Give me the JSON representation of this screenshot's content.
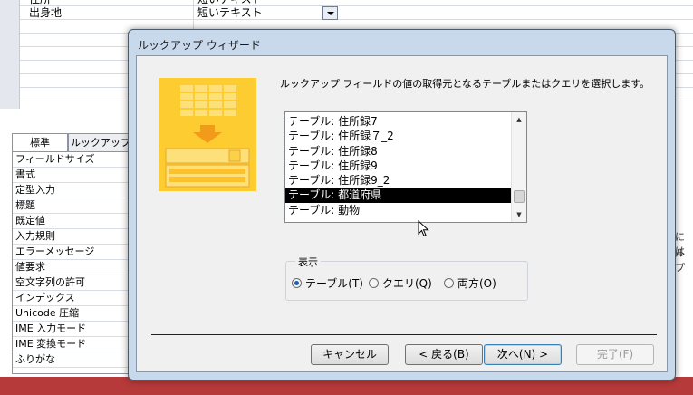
{
  "background": {
    "field_rows": [
      {
        "name": "住所",
        "type": "短いテキスト"
      },
      {
        "name": "出身地",
        "type": "短いテキスト"
      }
    ],
    "tabs": [
      "標準",
      "ルックアップ"
    ],
    "properties": [
      "フィールドサイズ",
      "書式",
      "定型入力",
      "標題",
      "既定値",
      "入力規則",
      "エラーメッセージ",
      "値要求",
      "空文字列の許可",
      "インデックス",
      "Unicode 圧縮",
      "IME 入力モード",
      "IME 変換モード",
      "ふりがな"
    ],
    "side_texts": [
      "には",
      "ルプ"
    ]
  },
  "dialog": {
    "title": "ルックアップ ウィザード",
    "instruction": "ルックアップ フィールドの値の取得元となるテーブルまたはクエリを選択します。",
    "list_items": [
      "テーブル: 住所録7",
      "テーブル: 住所録７_2",
      "テーブル: 住所録8",
      "テーブル: 住所録9",
      "テーブル: 住所録9_2",
      "テーブル: 都道府県",
      "テーブル: 動物"
    ],
    "selected_index": 5,
    "group_label": "表示",
    "radios": [
      {
        "label": "テーブル(T)",
        "checked": true
      },
      {
        "label": "クエリ(Q)",
        "checked": false
      },
      {
        "label": "両方(O)",
        "checked": false
      }
    ],
    "buttons": {
      "cancel": "キャンセル",
      "back": "< 戻る(B)",
      "next": "次へ(N) >",
      "finish": "完了(F)"
    }
  },
  "colors": {
    "accent": "#1d5fb0",
    "graphic": "#fccc30",
    "bottom_bar": "#b63a3a"
  }
}
